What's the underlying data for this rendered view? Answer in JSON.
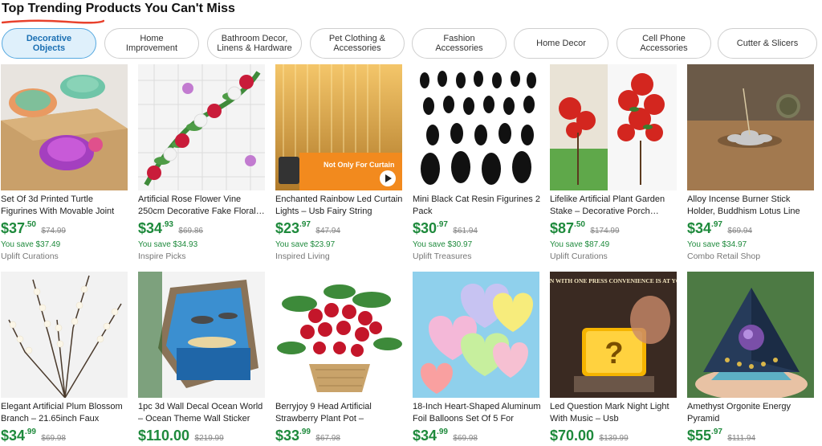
{
  "header": {
    "title": "Top Trending Products You Can't Miss"
  },
  "tabs": [
    {
      "label": "Decorative Objects"
    },
    {
      "label": "Home Improvement"
    },
    {
      "label": "Bathroom Decor, Linens & Hardware"
    },
    {
      "label": "Pet Clothing & Accessories"
    },
    {
      "label": "Fashion Accessories"
    },
    {
      "label": "Home Decor"
    },
    {
      "label": "Cell Phone Accessories"
    },
    {
      "label": "Cutter & Slicers"
    }
  ],
  "products": [
    {
      "title": "Set Of 3d Printed Turtle Figurines With Movable Joint Desk…",
      "price_main": "$37",
      "price_cents": ".50",
      "was": "$74.99",
      "save": "You save $37.49",
      "seller": "Uplift Curations"
    },
    {
      "title": "Artificial Rose Flower Vine 250cm Decorative Fake Floral…",
      "price_main": "$34",
      "price_cents": ".93",
      "was": "$69.86",
      "save": "You save $34.93",
      "seller": "Inspire Picks"
    },
    {
      "title": "Enchanted Rainbow Led Curtain Lights – Usb Fairy String Lights…",
      "price_main": "$23",
      "price_cents": ".97",
      "was": "$47.94",
      "save": "You save $23.97",
      "seller": "Inspired Living",
      "badge": "Not Only For Curtain"
    },
    {
      "title": "Mini Black Cat Resin Figurines 2 Pack",
      "price_main": "$30",
      "price_cents": ".97",
      "was": "$61.94",
      "save": "You save $30.97",
      "seller": "Uplift Treasures"
    },
    {
      "title": "Lifelike Artificial Plant Garden Stake – Decorative Porch…",
      "price_main": "$87",
      "price_cents": ".50",
      "was": "$174.99",
      "save": "You save $87.49",
      "seller": "Uplift Curations"
    },
    {
      "title": "Alloy Incense Burner Stick Holder, Buddhism Lotus Line Incense…",
      "price_main": "$34",
      "price_cents": ".97",
      "was": "$69.94",
      "save": "You save $34.97",
      "seller": "Combo Retail Shop"
    },
    {
      "title": "Elegant Artificial Plum Blossom Branch – 21.65inch Faux White…",
      "price_main": "$34",
      "price_cents": ".99",
      "was": "$69.98"
    },
    {
      "title": "1pc 3d Wall Decal Ocean World – Ocean Theme Wall Sticker Self-…",
      "price_main": "$110.00",
      "price_cents": "",
      "was": "$219.99"
    },
    {
      "title": "Berryjoy 9 Head Artificial Strawberry Plant Pot – Realistic…",
      "price_main": "$33",
      "price_cents": ".99",
      "was": "$67.98"
    },
    {
      "title": "18-Inch Heart-Shaped Aluminum Foil Balloons Set Of 5 For Party…",
      "price_main": "$34",
      "price_cents": ".99",
      "was": "$69.98"
    },
    {
      "title": "Led Question Mark Night Light With Music – Usb Rechargeable…",
      "price_main": "$70.00",
      "price_cents": "",
      "was": "$139.99",
      "banner": "OPEN WITH ONE PRESS CONVENIENCE IS AT YOUR"
    },
    {
      "title": "Amethyst Orgonite Energy Pyramid",
      "price_main": "$55",
      "price_cents": ".97",
      "was": "$111.94"
    }
  ],
  "colors": {
    "accent": "#1e8a3c",
    "active_tab_bg": "#dff0fb",
    "active_tab_border": "#56a9e0",
    "underline": "#e8412c"
  }
}
